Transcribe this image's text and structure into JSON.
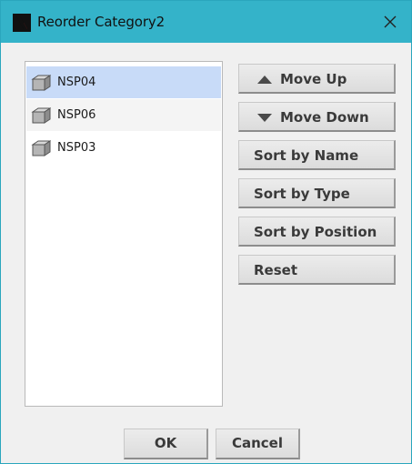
{
  "window": {
    "title": "Reorder Category2",
    "title_bar_color": "#34b3c9",
    "logo_letter": "N",
    "close_icon": "close-icon"
  },
  "list": {
    "item_icon": "cube-icon",
    "items": [
      {
        "label": "NSP04",
        "selected": true
      },
      {
        "label": "NSP06",
        "selected": false
      },
      {
        "label": "NSP03",
        "selected": false
      }
    ]
  },
  "actions": {
    "move_up": "Move Up",
    "move_down": "Move Down",
    "sort_by_name": "Sort by Name",
    "sort_by_type": "Sort by Type",
    "sort_by_position": "Sort by Position",
    "reset": "Reset"
  },
  "footer": {
    "ok": "OK",
    "cancel": "Cancel"
  },
  "colors": {
    "selection": "#c8dbf8",
    "button_text": "#3a3a3a"
  }
}
